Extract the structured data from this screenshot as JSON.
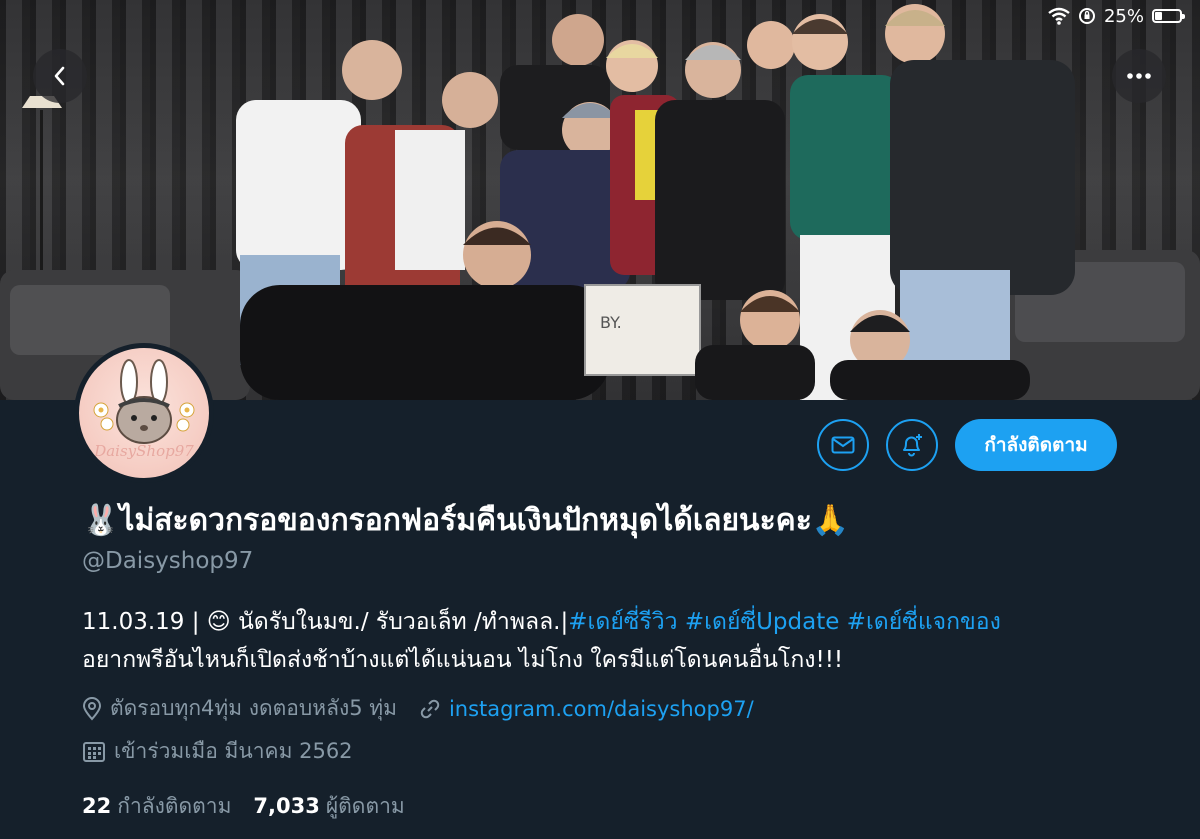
{
  "status_bar": {
    "battery_text": "25%",
    "battery_level": 0.25
  },
  "header": {
    "back_icon": "chevron-left-icon",
    "more_icon": "more-horizontal-icon"
  },
  "profile": {
    "avatar_text": "DaisyShop97",
    "display_name": "🐰ไม่สะดวกรอของกรอกฟอร์มคืนเงินปักหมุดได้เลยนะคะ🙏",
    "handle": "@Daisyshop97",
    "bio_line1_prefix": "11.03.19 | 😊 นัดรับในมข./ รับวอเล็ท /ทำพลล.|",
    "bio_hashtags": [
      "#เดย์ซี่รีวิว",
      "#เดย์ซี่Update",
      "#เดย์ซี่แจกของ"
    ],
    "bio_line2": "อยากพรีอันไหนก็เปิดส่งช้าบ้างแต่ได้แน่นอน ไม่โกง ใครมีแต่โดนคนอื่นโกง!!!",
    "location": "ตัดรอบทุก4ทุ่ม งดตอบหลัง5 ทุ่ม",
    "website": "instagram.com/daisyshop97/",
    "joined": "เข้าร่วมเมือ มีนาคม 2562",
    "following_count": "22",
    "following_label": "กำลังติดตาม",
    "followers_count": "7,033",
    "followers_label": "ผู้ติดตาม"
  },
  "actions": {
    "message_icon": "mail-icon",
    "notify_icon": "bell-plus-icon",
    "follow_label": "กำลังติดตาม"
  },
  "colors": {
    "background": "#15202b",
    "accent": "#1da1f2",
    "secondary_text": "#8899a6"
  }
}
